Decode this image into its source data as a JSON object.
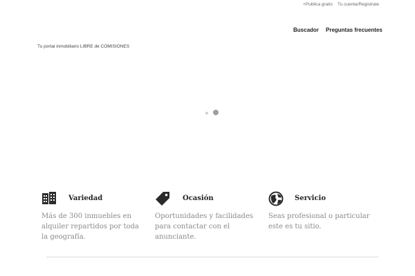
{
  "topbar": {
    "publish_label": "+Publica gratis",
    "account_label": "Tu cuenta/Registrate"
  },
  "nav": {
    "search_label": "Buscador",
    "faq_label": "Preguntas frecuentes"
  },
  "tagline": "Tu portal inmobiliario LIBRE de COMISIONES",
  "slider": {
    "dot_count": 2,
    "active_index": 1
  },
  "features": [
    {
      "icon": "buildings-icon",
      "title": "Variedad",
      "description": "Más de 300 inmuebles en alquiler repartidos por toda la geografía."
    },
    {
      "icon": "price-tag-icon",
      "title": "Ocasión",
      "description": "Oportunidades y facilidades para contactar con el anunciante."
    },
    {
      "icon": "globe-icon",
      "title": "Servicio",
      "description": "Seas profesional o particular este es tu sitio."
    }
  ],
  "colors": {
    "text_dark": "#222222",
    "text_muted": "#8a8a8a",
    "icon": "#2b2b2b"
  }
}
